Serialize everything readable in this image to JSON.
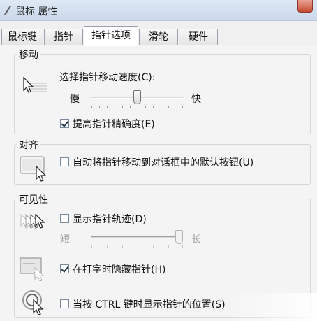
{
  "window": {
    "title": "鼠标 属性"
  },
  "tabs": [
    {
      "label": "鼠标键",
      "active": false
    },
    {
      "label": "指针",
      "active": false
    },
    {
      "label": "指针选项",
      "active": true
    },
    {
      "label": "滑轮",
      "active": false
    },
    {
      "label": "硬件",
      "active": false
    }
  ],
  "motion": {
    "group_title": "移动",
    "speed_label": "选择指针移动速度(C):",
    "slow_label": "慢",
    "fast_label": "快",
    "speed_value_fraction": 0.5,
    "precision_label": "提高指针精确度(E)",
    "precision_checked": true
  },
  "snap": {
    "group_title": "对齐",
    "snap_label": "自动将指针移动到对话框中的默认按钮(U)",
    "snap_checked": false
  },
  "visibility": {
    "group_title": "可见性",
    "trails_label": "显示指针轨迹(D)",
    "trails_checked": false,
    "short_label": "短",
    "long_label": "长",
    "trails_value_fraction": 1.0,
    "hide_typing_label": "在打字时隐藏指针(H)",
    "hide_typing_checked": true,
    "ctrl_label": "当按 CTRL 键时显示指针的位置(S)",
    "ctrl_checked": false
  }
}
